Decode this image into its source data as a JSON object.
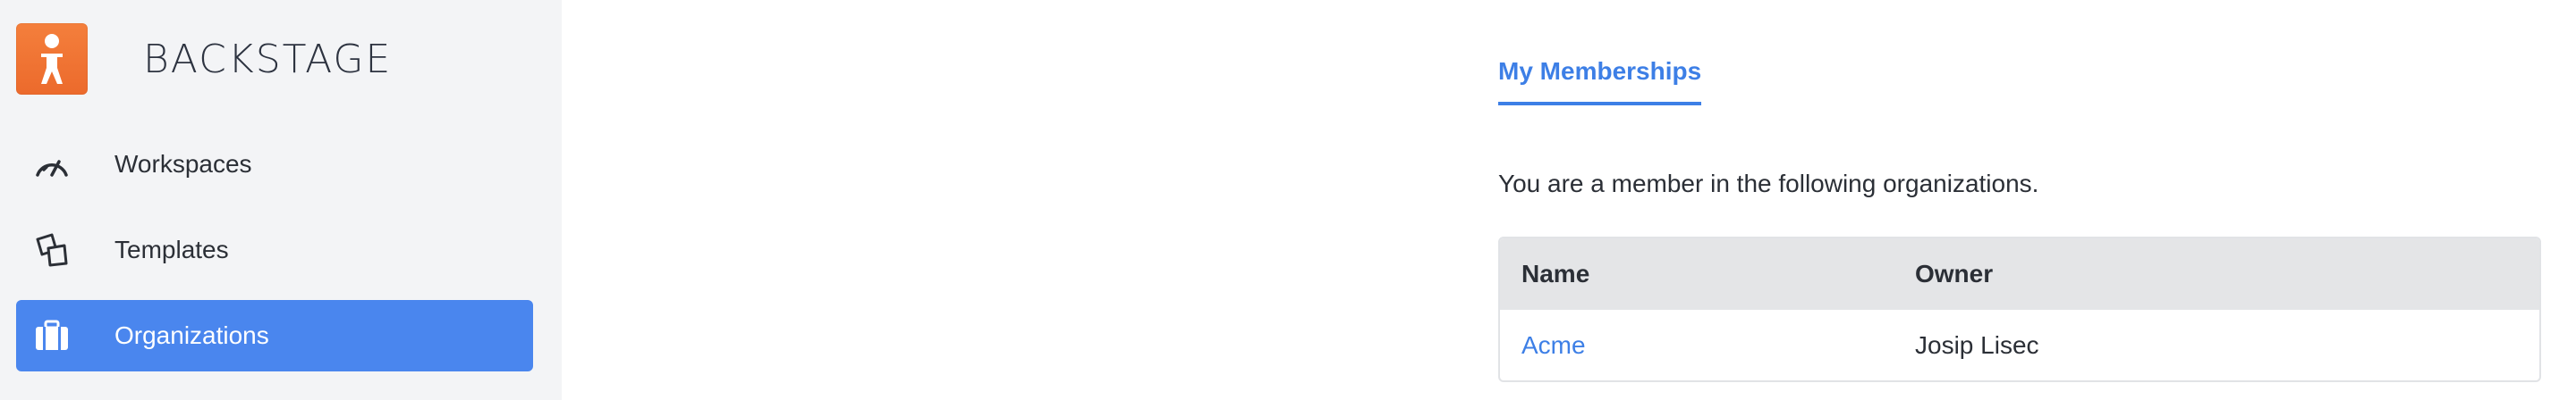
{
  "app": {
    "brand": "BACKSTAGE",
    "brand_color": "#f07431",
    "accent": "#4a86ee"
  },
  "sidebar": {
    "items": [
      {
        "label": "Workspaces",
        "icon": "gauge-icon",
        "active": false
      },
      {
        "label": "Templates",
        "icon": "stacked-cards-icon",
        "active": false
      },
      {
        "label": "Organizations",
        "icon": "briefcase-icon",
        "active": true
      }
    ]
  },
  "main": {
    "tab": "My Memberships",
    "intro": "You are a member in the following organizations.",
    "table": {
      "headers": [
        "Name",
        "Owner"
      ],
      "rows": [
        {
          "name": "Acme",
          "owner": "Josip Lisec"
        }
      ]
    }
  }
}
